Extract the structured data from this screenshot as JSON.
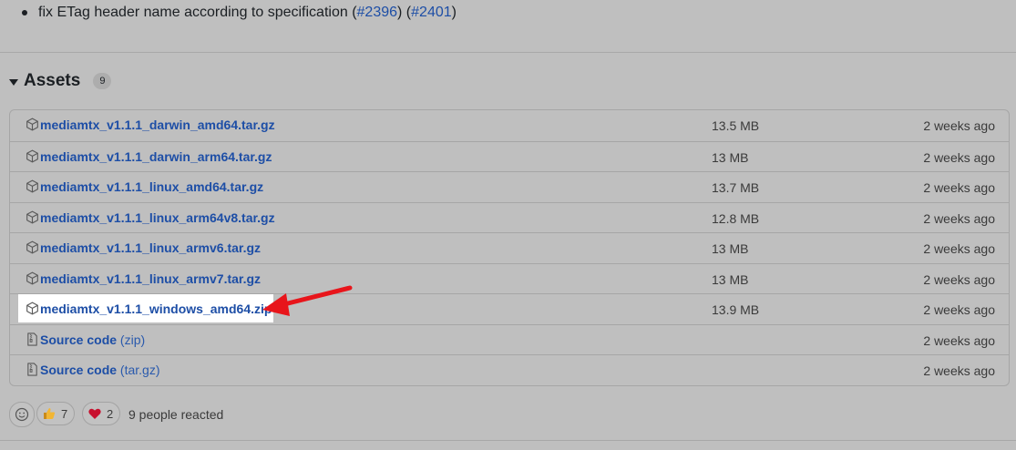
{
  "release_note": {
    "text": "fix ETag header name according to specification",
    "links": [
      "#2396",
      "#2401"
    ]
  },
  "assets": {
    "title": "Assets",
    "count": "9",
    "items": [
      {
        "name": "mediamtx_v1.1.1_darwin_amd64.tar.gz",
        "suffix": "",
        "size": "13.5 MB",
        "date": "2 weeks ago",
        "icon": "package-icon"
      },
      {
        "name": "mediamtx_v1.1.1_darwin_arm64.tar.gz",
        "suffix": "",
        "size": "13 MB",
        "date": "2 weeks ago",
        "icon": "package-icon"
      },
      {
        "name": "mediamtx_v1.1.1_linux_amd64.tar.gz",
        "suffix": "",
        "size": "13.7 MB",
        "date": "2 weeks ago",
        "icon": "package-icon"
      },
      {
        "name": "mediamtx_v1.1.1_linux_arm64v8.tar.gz",
        "suffix": "",
        "size": "12.8 MB",
        "date": "2 weeks ago",
        "icon": "package-icon"
      },
      {
        "name": "mediamtx_v1.1.1_linux_armv6.tar.gz",
        "suffix": "",
        "size": "13 MB",
        "date": "2 weeks ago",
        "icon": "package-icon"
      },
      {
        "name": "mediamtx_v1.1.1_linux_armv7.tar.gz",
        "suffix": "",
        "size": "13 MB",
        "date": "2 weeks ago",
        "icon": "package-icon"
      },
      {
        "name": "mediamtx_v1.1.1_windows_amd64.zip",
        "suffix": "",
        "size": "13.9 MB",
        "date": "2 weeks ago",
        "icon": "package-icon"
      },
      {
        "name": "Source code",
        "suffix": "(zip)",
        "size": "",
        "date": "2 weeks ago",
        "icon": "file-zip-icon"
      },
      {
        "name": "Source code",
        "suffix": "(tar.gz)",
        "size": "",
        "date": "2 weeks ago",
        "icon": "file-zip-icon"
      }
    ]
  },
  "reactions": {
    "thumbs_up": "7",
    "heart": "2",
    "summary": "9 people reacted"
  },
  "colors": {
    "link": "#1d4ea6",
    "arrow": "#e8151b",
    "highlight": "#ffffff"
  }
}
